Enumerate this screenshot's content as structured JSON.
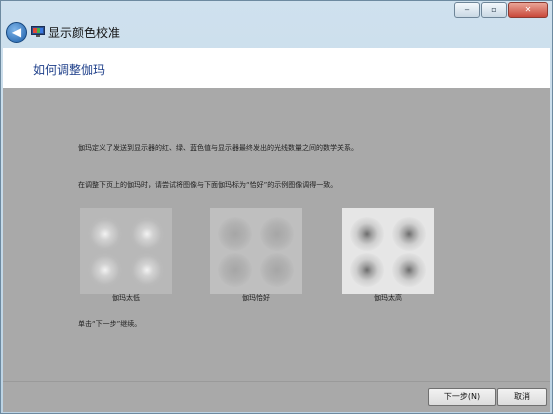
{
  "window": {
    "title": "显示颜色校准",
    "min_glyph": "‒",
    "max_glyph": "▫",
    "close_glyph": "✕"
  },
  "header": {
    "heading": "如何调整伽玛"
  },
  "main": {
    "description": "伽玛定义了发送到显示器的红、绿、蓝色值与显示器最终发出的光线数量之间的数学关系。",
    "instruction": "在调整下页上的伽玛时，请尝试将图像与下面伽玛标为“恰好”的示例图像调得一致。",
    "samples": [
      {
        "label": "伽玛太低"
      },
      {
        "label": "伽玛恰好"
      },
      {
        "label": "伽玛太高"
      }
    ],
    "hint": "单击“下一步”继续。"
  },
  "footer": {
    "next_label": "下一步(N)",
    "cancel_label": "取消"
  }
}
